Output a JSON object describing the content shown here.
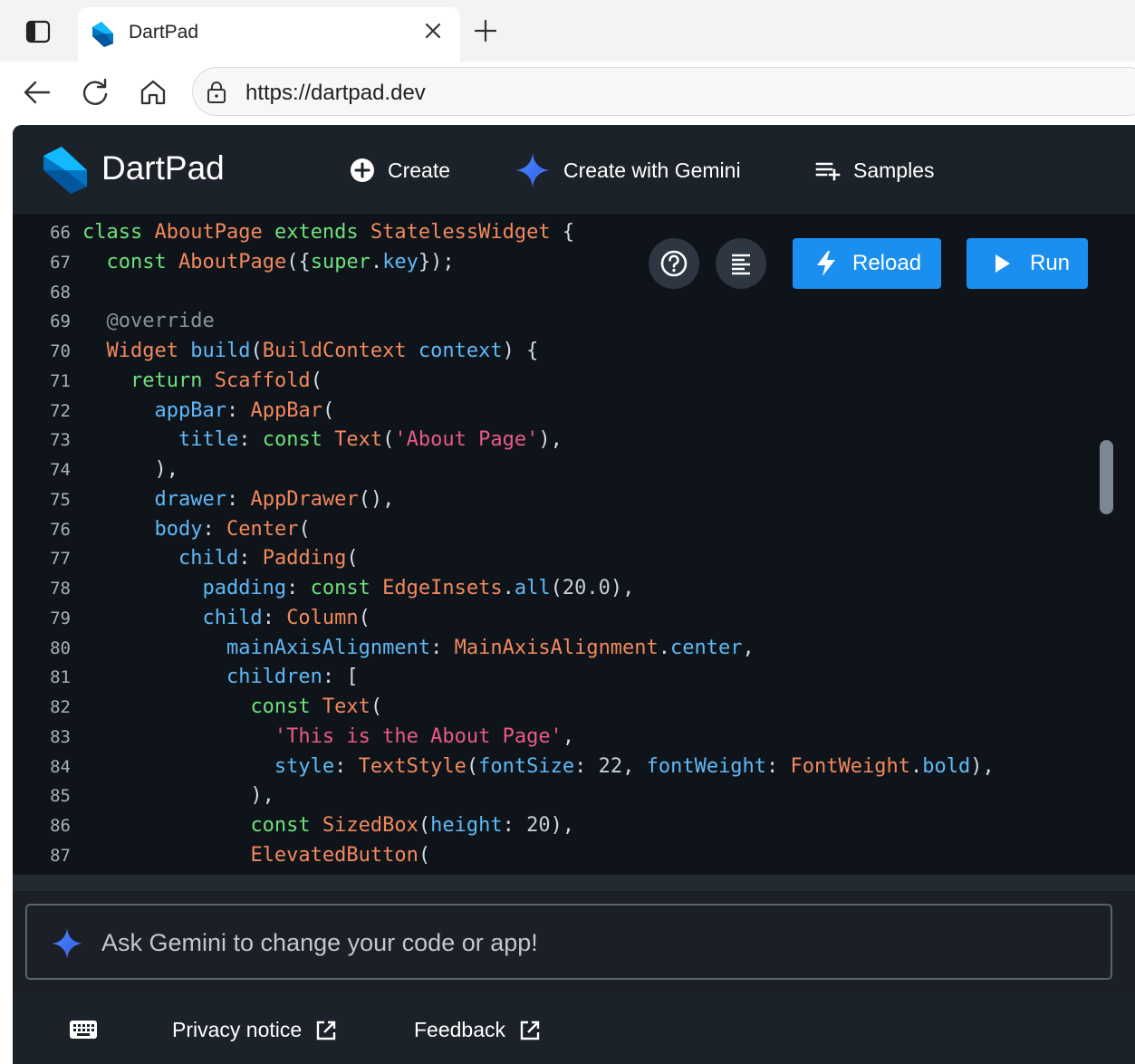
{
  "browser": {
    "tab": {
      "title": "DartPad",
      "favicon": "dart-logo-icon"
    },
    "address_url": "https://dartpad.dev"
  },
  "app": {
    "title": "DartPad",
    "menu": [
      {
        "label": "Create",
        "icon": "add-circle-icon"
      },
      {
        "label": "Create with Gemini",
        "icon": "gemini-sparkle-icon"
      },
      {
        "label": "Samples",
        "icon": "playlist-add-icon"
      }
    ],
    "actions": {
      "reload_label": "Reload",
      "run_label": "Run"
    },
    "colors": {
      "accent": "#1a8ff0",
      "keyword": "#6fe07a",
      "type": "#f2895c",
      "property": "#5fb9f6",
      "string": "#e85a86"
    }
  },
  "editor": {
    "lines": [
      {
        "num": "66",
        "tokens": [
          [
            "kw",
            "class"
          ],
          [
            "pl",
            " "
          ],
          [
            "ty",
            "AboutPage"
          ],
          [
            "pl",
            " "
          ],
          [
            "kw",
            "extends"
          ],
          [
            "pl",
            " "
          ],
          [
            "ty",
            "StatelessWidget"
          ],
          [
            "pl",
            " {"
          ]
        ]
      },
      {
        "num": "67",
        "tokens": [
          [
            "pl",
            "  "
          ],
          [
            "kw",
            "const"
          ],
          [
            "pl",
            " "
          ],
          [
            "ty",
            "AboutPage"
          ],
          [
            "pl",
            "({"
          ],
          [
            "kw",
            "super"
          ],
          [
            "pl",
            "."
          ],
          [
            "pr",
            "key"
          ],
          [
            "pl",
            "});"
          ]
        ]
      },
      {
        "num": "68",
        "tokens": []
      },
      {
        "num": "69",
        "tokens": [
          [
            "pl",
            "  "
          ],
          [
            "an",
            "@override"
          ]
        ]
      },
      {
        "num": "70",
        "tokens": [
          [
            "pl",
            "  "
          ],
          [
            "ty",
            "Widget"
          ],
          [
            "pl",
            " "
          ],
          [
            "pr",
            "build"
          ],
          [
            "pl",
            "("
          ],
          [
            "ty",
            "BuildContext"
          ],
          [
            "pl",
            " "
          ],
          [
            "pr",
            "context"
          ],
          [
            "pl",
            ") {"
          ]
        ]
      },
      {
        "num": "71",
        "tokens": [
          [
            "pl",
            "    "
          ],
          [
            "kw",
            "return"
          ],
          [
            "pl",
            " "
          ],
          [
            "ty",
            "Scaffold"
          ],
          [
            "pl",
            "("
          ]
        ]
      },
      {
        "num": "72",
        "tokens": [
          [
            "pl",
            "      "
          ],
          [
            "pr",
            "appBar"
          ],
          [
            "pl",
            ": "
          ],
          [
            "ty",
            "AppBar"
          ],
          [
            "pl",
            "("
          ]
        ]
      },
      {
        "num": "73",
        "tokens": [
          [
            "pl",
            "        "
          ],
          [
            "pr",
            "title"
          ],
          [
            "pl",
            ": "
          ],
          [
            "kw",
            "const"
          ],
          [
            "pl",
            " "
          ],
          [
            "ty",
            "Text"
          ],
          [
            "pl",
            "("
          ],
          [
            "st",
            "'About Page'"
          ],
          [
            "pl",
            "),"
          ]
        ]
      },
      {
        "num": "74",
        "tokens": [
          [
            "pl",
            "      ),"
          ]
        ]
      },
      {
        "num": "75",
        "tokens": [
          [
            "pl",
            "      "
          ],
          [
            "pr",
            "drawer"
          ],
          [
            "pl",
            ": "
          ],
          [
            "ty",
            "AppDrawer"
          ],
          [
            "pl",
            "(),"
          ]
        ]
      },
      {
        "num": "76",
        "tokens": [
          [
            "pl",
            "      "
          ],
          [
            "pr",
            "body"
          ],
          [
            "pl",
            ": "
          ],
          [
            "ty",
            "Center"
          ],
          [
            "pl",
            "("
          ]
        ]
      },
      {
        "num": "77",
        "tokens": [
          [
            "pl",
            "        "
          ],
          [
            "pr",
            "child"
          ],
          [
            "pl",
            ": "
          ],
          [
            "ty",
            "Padding"
          ],
          [
            "pl",
            "("
          ]
        ]
      },
      {
        "num": "78",
        "tokens": [
          [
            "pl",
            "          "
          ],
          [
            "pr",
            "padding"
          ],
          [
            "pl",
            ": "
          ],
          [
            "kw",
            "const"
          ],
          [
            "pl",
            " "
          ],
          [
            "ty",
            "EdgeInsets"
          ],
          [
            "pl",
            "."
          ],
          [
            "pr",
            "all"
          ],
          [
            "pl",
            "("
          ],
          [
            "nm",
            "20.0"
          ],
          [
            "pl",
            "),"
          ]
        ]
      },
      {
        "num": "79",
        "tokens": [
          [
            "pl",
            "          "
          ],
          [
            "pr",
            "child"
          ],
          [
            "pl",
            ": "
          ],
          [
            "ty",
            "Column"
          ],
          [
            "pl",
            "("
          ]
        ]
      },
      {
        "num": "80",
        "tokens": [
          [
            "pl",
            "            "
          ],
          [
            "pr",
            "mainAxisAlignment"
          ],
          [
            "pl",
            ": "
          ],
          [
            "ty",
            "MainAxisAlignment"
          ],
          [
            "pl",
            "."
          ],
          [
            "pr",
            "center"
          ],
          [
            "pl",
            ","
          ]
        ]
      },
      {
        "num": "81",
        "tokens": [
          [
            "pl",
            "            "
          ],
          [
            "pr",
            "children"
          ],
          [
            "pl",
            ": ["
          ]
        ]
      },
      {
        "num": "82",
        "tokens": [
          [
            "pl",
            "              "
          ],
          [
            "kw",
            "const"
          ],
          [
            "pl",
            " "
          ],
          [
            "ty",
            "Text"
          ],
          [
            "pl",
            "("
          ]
        ]
      },
      {
        "num": "83",
        "tokens": [
          [
            "pl",
            "                "
          ],
          [
            "st",
            "'This is the About Page'"
          ],
          [
            "pl",
            ","
          ]
        ]
      },
      {
        "num": "84",
        "tokens": [
          [
            "pl",
            "                "
          ],
          [
            "pr",
            "style"
          ],
          [
            "pl",
            ": "
          ],
          [
            "ty",
            "TextStyle"
          ],
          [
            "pl",
            "("
          ],
          [
            "pr",
            "fontSize"
          ],
          [
            "pl",
            ": "
          ],
          [
            "nm",
            "22"
          ],
          [
            "pl",
            ", "
          ],
          [
            "pr",
            "fontWeight"
          ],
          [
            "pl",
            ": "
          ],
          [
            "ty",
            "FontWeight"
          ],
          [
            "pl",
            "."
          ],
          [
            "pr",
            "bold"
          ],
          [
            "pl",
            "),"
          ]
        ]
      },
      {
        "num": "85",
        "tokens": [
          [
            "pl",
            "              ),"
          ]
        ]
      },
      {
        "num": "86",
        "tokens": [
          [
            "pl",
            "              "
          ],
          [
            "kw",
            "const"
          ],
          [
            "pl",
            " "
          ],
          [
            "ty",
            "SizedBox"
          ],
          [
            "pl",
            "("
          ],
          [
            "pr",
            "height"
          ],
          [
            "pl",
            ": "
          ],
          [
            "nm",
            "20"
          ],
          [
            "pl",
            "),"
          ]
        ]
      },
      {
        "num": "87",
        "tokens": [
          [
            "pl",
            "              "
          ],
          [
            "ty",
            "ElevatedButton"
          ],
          [
            "pl",
            "("
          ]
        ]
      }
    ]
  },
  "prompt": {
    "placeholder": "Ask Gemini to change your code or app!"
  },
  "footer": {
    "links": [
      {
        "label": "Privacy notice",
        "icon": "open-in-new-icon"
      },
      {
        "label": "Feedback",
        "icon": "open-in-new-icon"
      }
    ],
    "keyboard_icon": "keyboard-icon"
  }
}
